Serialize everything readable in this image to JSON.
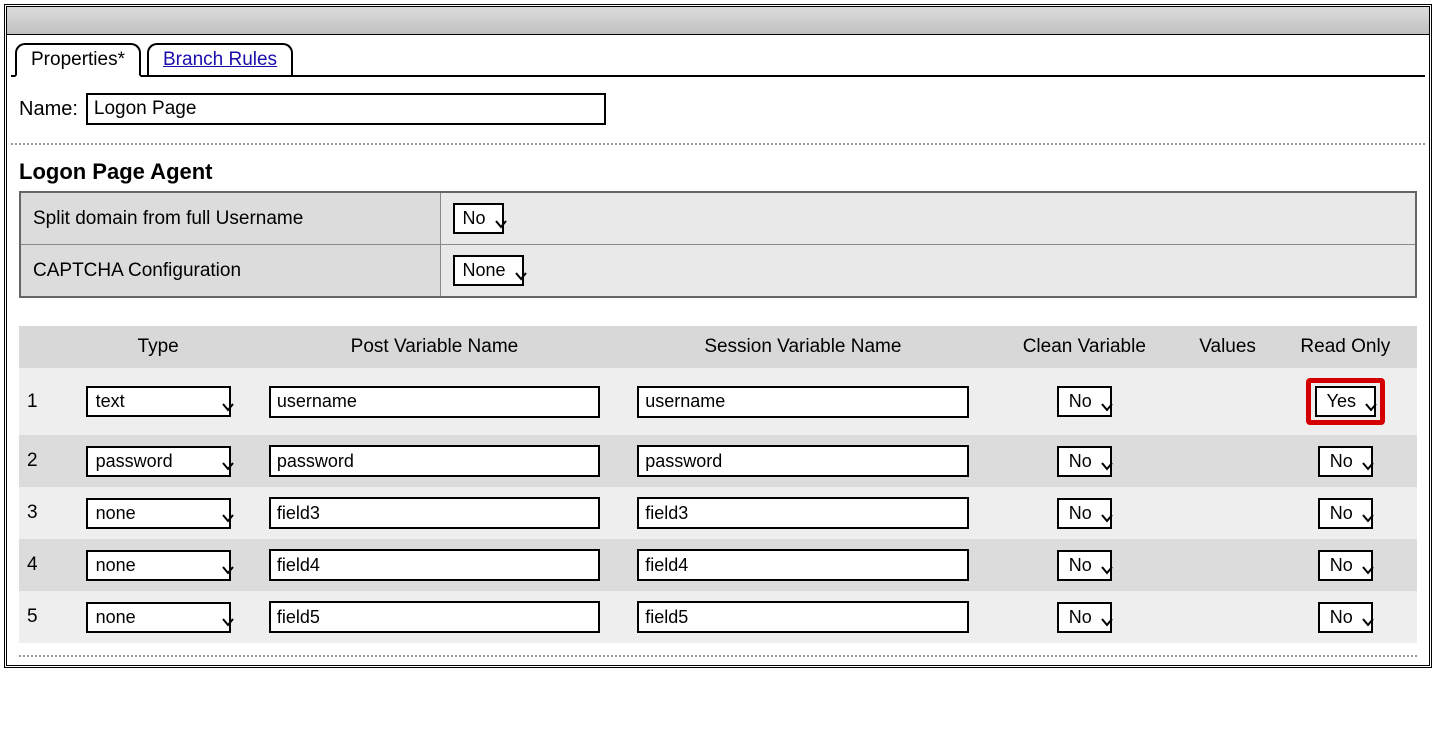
{
  "tabs": {
    "properties": "Properties*",
    "branch_rules": "Branch Rules"
  },
  "name_label": "Name:",
  "name_value": "Logon Page",
  "section_title": "Logon Page Agent",
  "config": {
    "split_domain_label": "Split domain from full Username",
    "split_domain_value": "No",
    "captcha_label": "CAPTCHA Configuration",
    "captcha_value": "None"
  },
  "grid": {
    "headers": {
      "type": "Type",
      "post_var": "Post Variable Name",
      "session_var": "Session Variable Name",
      "clean_var": "Clean Variable",
      "values": "Values",
      "read_only": "Read Only"
    },
    "rows": [
      {
        "num": "1",
        "type": "text",
        "post": "username",
        "session": "username",
        "clean": "No",
        "readonly": "Yes",
        "highlight": true
      },
      {
        "num": "2",
        "type": "password",
        "post": "password",
        "session": "password",
        "clean": "No",
        "readonly": "No",
        "highlight": false
      },
      {
        "num": "3",
        "type": "none",
        "post": "field3",
        "session": "field3",
        "clean": "No",
        "readonly": "No",
        "highlight": false
      },
      {
        "num": "4",
        "type": "none",
        "post": "field4",
        "session": "field4",
        "clean": "No",
        "readonly": "No",
        "highlight": false
      },
      {
        "num": "5",
        "type": "none",
        "post": "field5",
        "session": "field5",
        "clean": "No",
        "readonly": "No",
        "highlight": false
      }
    ]
  }
}
